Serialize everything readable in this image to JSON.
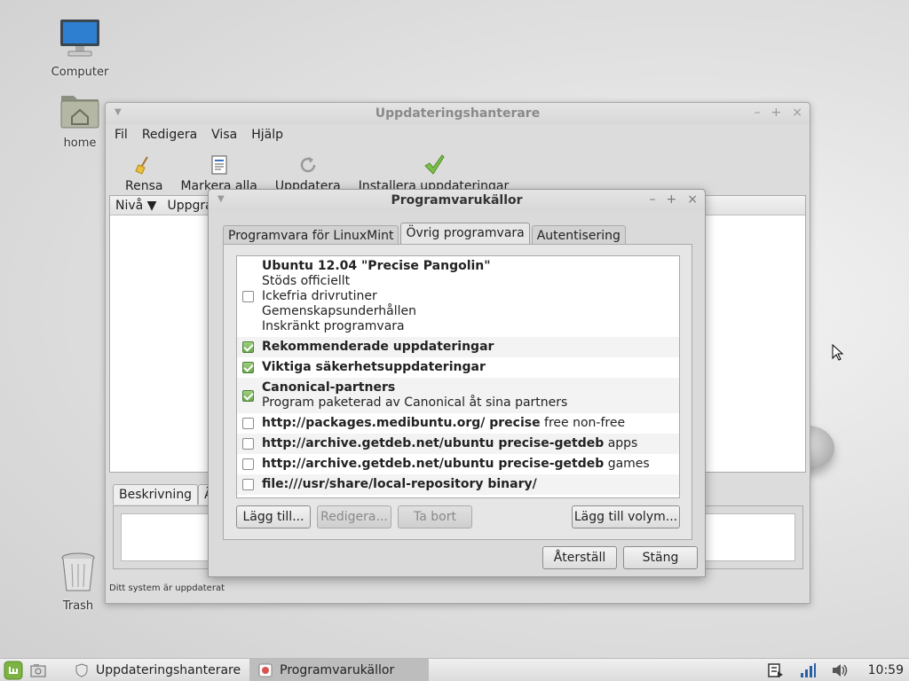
{
  "desktop": {
    "icons": [
      {
        "label": "Computer"
      },
      {
        "label": "home"
      },
      {
        "label": "Trash"
      }
    ]
  },
  "main_window": {
    "title": "Uppdateringshanterare",
    "menu": [
      "Fil",
      "Redigera",
      "Visa",
      "Hjälp"
    ],
    "toolbar": [
      {
        "label": "Rensa",
        "icon": "broom-icon"
      },
      {
        "label": "Markera alla",
        "icon": "document-icon"
      },
      {
        "label": "Uppdatera",
        "icon": "refresh-icon"
      },
      {
        "label": "Installera uppdateringar",
        "icon": "checkmark-icon"
      }
    ],
    "columns": [
      "Nivå ▼",
      "Uppgrad"
    ],
    "desc_tabs": [
      "Beskrivning",
      "Är"
    ],
    "status": "Ditt system är uppdaterat"
  },
  "dialog": {
    "title": "Programvarukällor",
    "tabs": [
      "Programvara för LinuxMint",
      "Övrig programvara",
      "Autentisering"
    ],
    "active_tab": "Övrig programvara",
    "sources": [
      {
        "checked": false,
        "bold": "Ubuntu 12.04 \"Precise Pangolin\"",
        "rest": "",
        "details": [
          "Stöds officiellt",
          "Ickefria drivrutiner",
          "Gemenskapsunderhållen",
          "Inskränkt programvara"
        ]
      },
      {
        "checked": true,
        "bold": "Rekommenderade uppdateringar",
        "rest": "",
        "details": []
      },
      {
        "checked": true,
        "bold": "Viktiga säkerhetsuppdateringar",
        "rest": "",
        "details": []
      },
      {
        "checked": true,
        "bold": "Canonical-partners",
        "rest": "",
        "details": [
          "Program paketerad av Canonical åt sina partners"
        ]
      },
      {
        "checked": false,
        "bold": "http://packages.medibuntu.org/ precise",
        "rest": " free non-free",
        "details": []
      },
      {
        "checked": false,
        "bold": "http://archive.getdeb.net/ubuntu precise-getdeb",
        "rest": " apps",
        "details": []
      },
      {
        "checked": false,
        "bold": "http://archive.getdeb.net/ubuntu precise-getdeb",
        "rest": " games",
        "details": []
      },
      {
        "checked": false,
        "bold": "file:///usr/share/local-repository binary/",
        "rest": "",
        "details": []
      }
    ],
    "buttons": {
      "add": "Lägg till...",
      "edit": "Redigera...",
      "remove": "Ta bort",
      "add_volume": "Lägg till volym...",
      "revert": "Återställ",
      "close": "Stäng"
    }
  },
  "taskbar": {
    "tasks": [
      {
        "label": "Uppdateringshanterare"
      },
      {
        "label": "Programvarukällor"
      }
    ],
    "clock": "10:59"
  }
}
